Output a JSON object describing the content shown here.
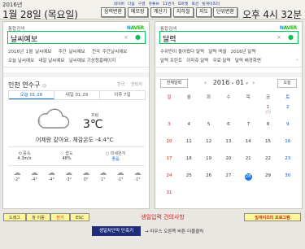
{
  "header": {
    "year": "2016년",
    "date": "1월 28일 (목요일)",
    "clock": "오후 4시 32분",
    "links": [
      "네이버",
      "다음",
      "구글",
      "유튜브",
      "11번가",
      "G마켓",
      "옥션",
      "빌게이츠티"
    ],
    "buttons": [
      "음력변환",
      "메모장",
      "계산기",
      "지하철",
      "지도",
      "단위변환"
    ]
  },
  "left": {
    "search_hint": "통합검색",
    "query": "날씨예보",
    "clear_icon": "×",
    "mic_icon": "●",
    "suggestions_line1": [
      "2016년 1월 날씨예보",
      "주간 날씨예보",
      "전국 주간날씨예보"
    ],
    "suggestions_line2": [
      "오늘 날씨예보",
      "내일 날씨예보",
      "날씨예보 기상청홈페이지"
    ],
    "location": "인천 연수구",
    "location_sep": "·",
    "meta": [
      "전국",
      "한파지"
    ],
    "tabs": [
      "오늘 01.28",
      "내일 01.29",
      "이후 7일"
    ],
    "weather": {
      "condition": "흐림",
      "temp": "3℃",
      "desc": "어제랑 같아요. 체감온도 -4.4°C",
      "icon": "cloudy-icon"
    },
    "stats": [
      {
        "label": "풍속",
        "value": "4.3m/s"
      },
      {
        "label": "습도",
        "value": "48%"
      },
      {
        "label": "미세먼지",
        "value": "좋음"
      }
    ],
    "hourly": [
      "-2°",
      "-4°",
      "-4°",
      "-3°",
      "0°",
      "1°",
      "-1°",
      "-1°"
    ],
    "hourly_times": [
      "",
      "",
      "",
      "",
      "",
      "",
      "",
      ""
    ]
  },
  "right": {
    "search_hint": "통합검색",
    "query": "달력",
    "clear_icon": "×",
    "mic_icon": "●",
    "suggestions_line1": [
      "수위먼이 돌아왔다 달력",
      "달력 엑셀",
      "2016년 달력"
    ],
    "suggestions_line2": [
      "달력 프린트",
      "이미쥬 달력",
      "무료 달력",
      "달력 배경화면"
    ],
    "cal_btn_all": "전체달력",
    "year": "2016",
    "month": "01",
    "today_btn": "오늘",
    "dows": [
      "일",
      "월",
      "화",
      "수",
      "목",
      "금",
      "토"
    ],
    "weeks": [
      [
        {
          "d": "",
          "s": ""
        },
        {
          "d": "",
          "s": ""
        },
        {
          "d": "",
          "s": ""
        },
        {
          "d": "",
          "s": ""
        },
        {
          "d": "",
          "s": ""
        },
        {
          "d": "1",
          "s": "신정"
        },
        {
          "d": "2",
          "s": ""
        }
      ],
      [
        {
          "d": "3",
          "s": ""
        },
        {
          "d": "4",
          "s": ""
        },
        {
          "d": "5",
          "s": ""
        },
        {
          "d": "6",
          "s": ""
        },
        {
          "d": "7",
          "s": ""
        },
        {
          "d": "8",
          "s": ""
        },
        {
          "d": "9",
          "s": ""
        }
      ],
      [
        {
          "d": "10",
          "s": ""
        },
        {
          "d": "11",
          "s": ""
        },
        {
          "d": "12",
          "s": ""
        },
        {
          "d": "13",
          "s": ""
        },
        {
          "d": "14",
          "s": ""
        },
        {
          "d": "15",
          "s": ""
        },
        {
          "d": "16",
          "s": ""
        }
      ],
      [
        {
          "d": "17",
          "s": ""
        },
        {
          "d": "18",
          "s": ""
        },
        {
          "d": "19",
          "s": ""
        },
        {
          "d": "20",
          "s": ""
        },
        {
          "d": "21",
          "s": ""
        },
        {
          "d": "22",
          "s": ""
        },
        {
          "d": "23",
          "s": ""
        }
      ],
      [
        {
          "d": "24",
          "s": ""
        },
        {
          "d": "25",
          "s": ""
        },
        {
          "d": "26",
          "s": ""
        },
        {
          "d": "27",
          "s": ""
        },
        {
          "d": "28",
          "s": ""
        },
        {
          "d": "29",
          "s": ""
        },
        {
          "d": "30",
          "s": ""
        }
      ],
      [
        {
          "d": "31",
          "s": ""
        },
        {
          "d": "",
          "s": ""
        },
        {
          "d": "",
          "s": ""
        },
        {
          "d": "",
          "s": ""
        },
        {
          "d": "",
          "s": ""
        },
        {
          "d": "",
          "s": ""
        },
        {
          "d": "",
          "s": ""
        }
      ]
    ],
    "today": "28"
  },
  "footer": {
    "drag": "드래그",
    "drag_move": "창 이동",
    "close": "닫기",
    "esc": "ESC",
    "center": "생일입력 건의사항",
    "right_btn": "빌게이츠티 프로그램",
    "shortcut": "생일차단막 단축키",
    "arrow_desc": "→ 마우스 오른쪽 버튼 더블클릭",
    "colors": {
      "red": "#d62020",
      "accent": "#1a73e8",
      "green": "#03c75a",
      "yellow": "#fff89a"
    }
  }
}
